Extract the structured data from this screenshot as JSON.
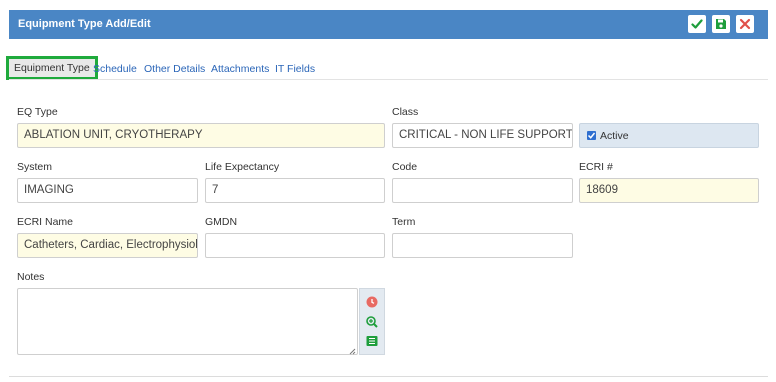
{
  "window": {
    "title": "Equipment Type Add/Edit"
  },
  "toolbar": {
    "confirm_icon": "check-icon",
    "save_icon": "save-icon",
    "close_icon": "close-icon"
  },
  "tabs": [
    {
      "label": "Equipment Type",
      "active": true
    },
    {
      "label": "Schedule",
      "active": false
    },
    {
      "label": "Other Details",
      "active": false
    },
    {
      "label": "Attachments",
      "active": false
    },
    {
      "label": "IT Fields",
      "active": false
    }
  ],
  "form": {
    "eq_type": {
      "label": "EQ Type",
      "value": "ABLATION UNIT, CRYOTHERAPY"
    },
    "class": {
      "label": "Class",
      "value": "CRITICAL - NON LIFE SUPPORT"
    },
    "active": {
      "label": "Active",
      "checked": true
    },
    "system": {
      "label": "System",
      "value": "IMAGING"
    },
    "life_expectancy": {
      "label": "Life Expectancy",
      "value": "7"
    },
    "code": {
      "label": "Code",
      "value": ""
    },
    "ecri_number": {
      "label": "ECRI #",
      "value": "18609"
    },
    "ecri_name": {
      "label": "ECRI Name",
      "value": "Catheters, Cardiac, Electrophysiolo"
    },
    "gmdn": {
      "label": "GMDN",
      "value": ""
    },
    "term": {
      "label": "Term",
      "value": ""
    },
    "notes": {
      "label": "Notes",
      "value": ""
    }
  },
  "colors": {
    "header": "#4a86c5",
    "accent_green": "#1faa3c",
    "required_bg": "#fefce4",
    "link": "#2b66b8"
  }
}
